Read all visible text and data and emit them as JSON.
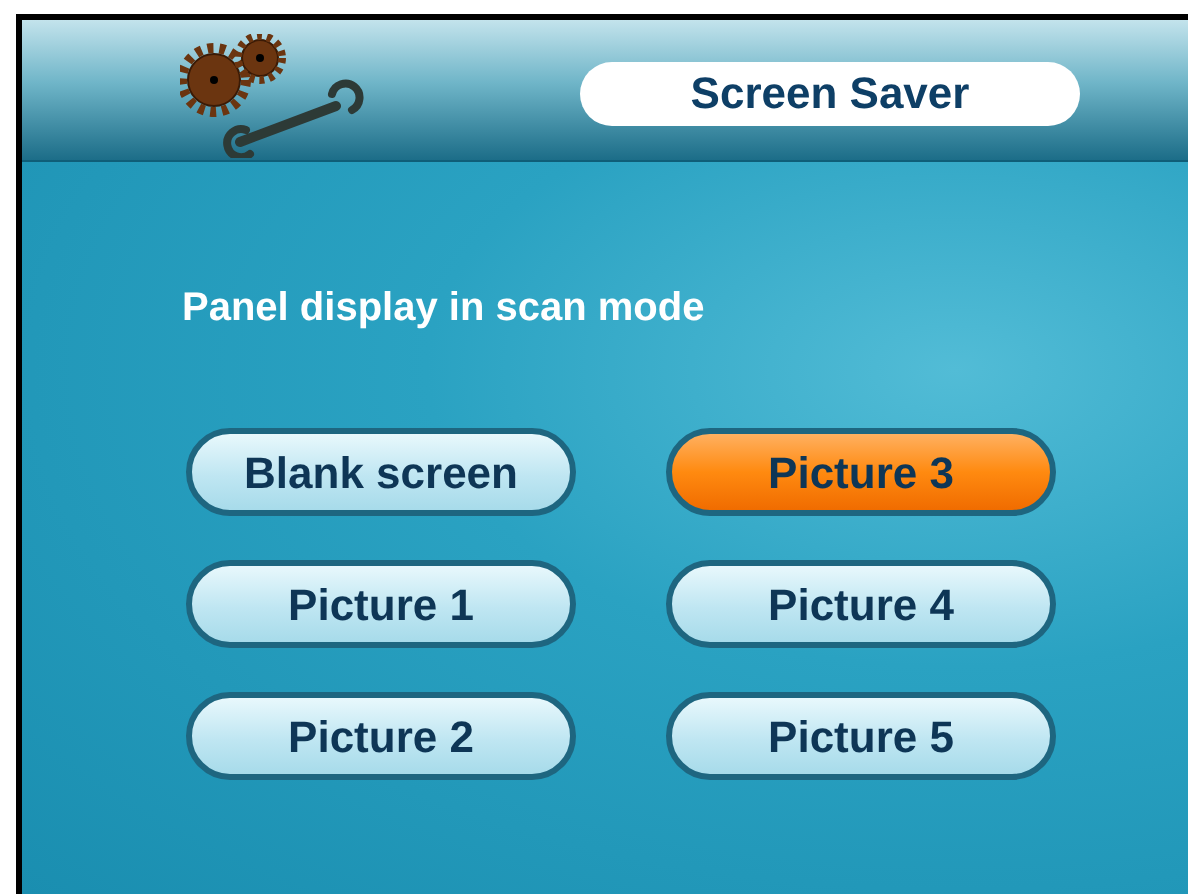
{
  "header": {
    "title": "Screen Saver"
  },
  "prompt": "Panel display in scan mode",
  "options": [
    {
      "label": "Blank screen",
      "selected": false
    },
    {
      "label": "Picture 3",
      "selected": true
    },
    {
      "label": "Picture 1",
      "selected": false
    },
    {
      "label": "Picture 4",
      "selected": false
    },
    {
      "label": "Picture 2",
      "selected": false
    },
    {
      "label": "Picture 5",
      "selected": false
    }
  ]
}
